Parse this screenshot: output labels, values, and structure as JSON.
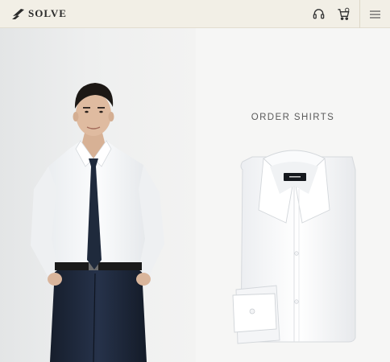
{
  "header": {
    "brand": "SOLVE",
    "icons": [
      "support-headset-icon",
      "cart-icon",
      "hamburger-menu-icon"
    ],
    "background": "#f2efe6"
  },
  "hero": {
    "left_panel": {
      "image": "model-wearing-white-shirt-and-navy-tie"
    },
    "right_panel": {
      "title": "ORDER SHIRTS",
      "image": "folded-white-dress-shirt"
    }
  },
  "colors": {
    "shirt": "#f7f8fa",
    "tie": "#1f2a3c",
    "trousers": "#1c2536",
    "text": "#5a5a5a"
  }
}
